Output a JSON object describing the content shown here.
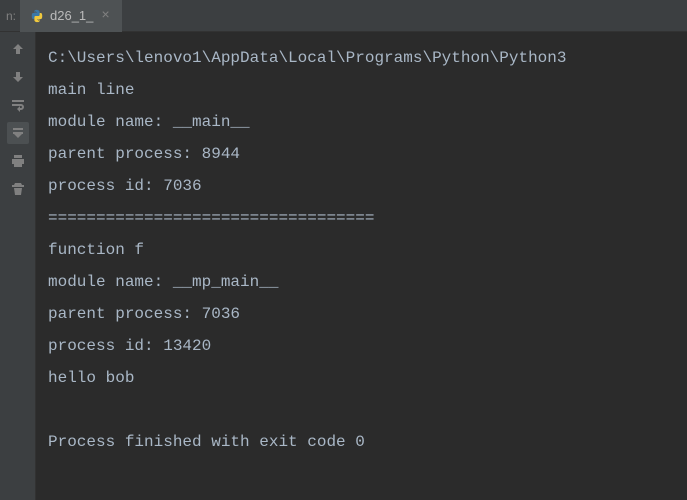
{
  "tabBar": {
    "prefix": "n:",
    "tab": {
      "title": "d26_1_",
      "iconName": "python-icon"
    }
  },
  "gutter": {
    "icons": [
      {
        "name": "arrow-up-icon"
      },
      {
        "name": "arrow-down-icon"
      },
      {
        "name": "wrap-icon"
      },
      {
        "name": "scroll-to-end-icon"
      },
      {
        "name": "print-icon"
      },
      {
        "name": "trash-icon"
      }
    ]
  },
  "output": {
    "lines": [
      "C:\\Users\\lenovo1\\AppData\\Local\\Programs\\Python\\Python3",
      "main line",
      "module name: __main__",
      "parent process: 8944",
      "process id: 7036",
      "==================================",
      "function f",
      "module name: __mp_main__",
      "parent process: 7036",
      "process id: 13420",
      "hello bob",
      "",
      "Process finished with exit code 0"
    ]
  }
}
